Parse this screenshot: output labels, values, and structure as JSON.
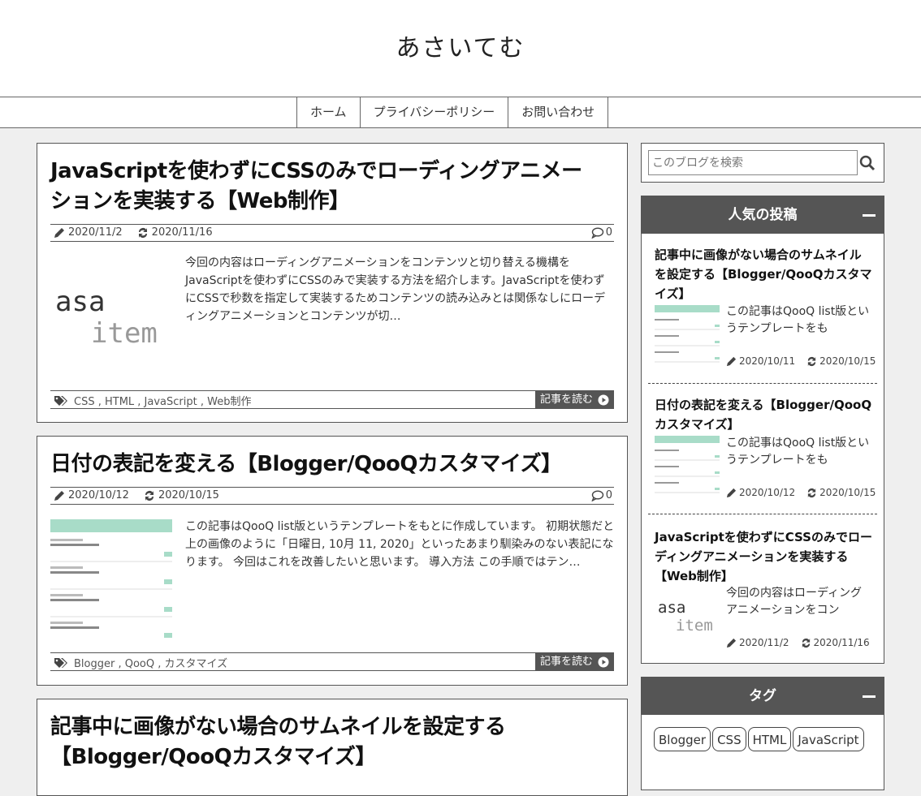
{
  "site": {
    "title": "あさいてむ"
  },
  "nav": {
    "items": [
      "ホーム",
      "プライバシーポリシー",
      "お問い合わせ"
    ]
  },
  "posts": [
    {
      "title_line1": "JavaScriptを使わずにCSSのみでローディングアニメー",
      "title_line2": "ションを実装する【Web制作】",
      "published": "2020/11/2",
      "updated": "2020/11/16",
      "comments": "0",
      "thumb_text1": "asa",
      "thumb_text2": "item",
      "excerpt": "今回の内容はローディングアニメーションをコンテンツと切り替える機構をJavaScriptを使わずにCSSのみで実装する方法を紹介します。JavaScriptを使わずにCSSで秒数を指定して実装するためコンテンツの読み込みとは関係なしにローディングアニメーションとコンテンツが切…",
      "labels": "CSS , HTML , JavaScript , Web制作",
      "readmore": "記事を読む"
    },
    {
      "title_line1": "日付の表記を変える【Blogger/QooQカスタマイズ】",
      "published": "2020/10/12",
      "updated": "2020/10/15",
      "comments": "0",
      "excerpt": "この記事はQooQ list版というテンプレートをもとに作成しています。 初期状態だと上の画像のように「日曜日, 10月 11, 2020」といったあまり馴染みのない表記になります。 今回はこれを改善したいと思います。 導入方法 この手順ではテン…",
      "labels": "Blogger , QooQ , カスタマイズ",
      "readmore": "記事を読む"
    },
    {
      "title_line1": "記事中に画像がない場合のサムネイルを設定する",
      "title_line2": "【Blogger/QooQカスタマイズ】"
    }
  ],
  "search": {
    "placeholder": "このブログを検索"
  },
  "popular": {
    "heading": "人気の投稿",
    "items": [
      {
        "title": "記事中に画像がない場合のサムネイルを設定する【Blogger/QooQカスタマイズ】",
        "excerpt": "この記事はQooQ list版というテンプレートをも",
        "published": "2020/10/11",
        "updated": "2020/10/15"
      },
      {
        "title": "日付の表記を変える【Blogger/QooQカスタマイズ】",
        "excerpt": "この記事はQooQ list版というテンプレートをも",
        "published": "2020/10/12",
        "updated": "2020/10/15"
      },
      {
        "title": "JavaScriptを使わずにCSSのみでローディングアニメーションを実装する【Web制作】",
        "excerpt": "今回の内容はローディングアニメーションをコン",
        "thumb_text1": "asa",
        "thumb_text2": "item",
        "published": "2020/11/2",
        "updated": "2020/11/16"
      }
    ]
  },
  "tags_widget": {
    "heading": "タグ",
    "tags": [
      "Blogger",
      "CSS",
      "HTML",
      "JavaScript"
    ]
  },
  "colors": {
    "accent": "#555555",
    "thumb_green": "#a8dcc8"
  }
}
